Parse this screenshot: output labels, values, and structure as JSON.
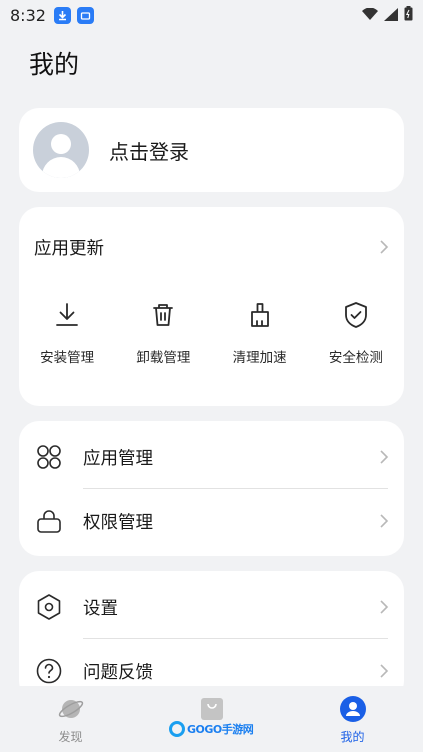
{
  "status_bar": {
    "time": "8:32",
    "icons": [
      "download-icon",
      "app-store-icon",
      "wifi-icon",
      "signal-icon",
      "battery-icon"
    ]
  },
  "page": {
    "title": "我的"
  },
  "login": {
    "label": "点击登录",
    "avatar_icon": "default-avatar-icon"
  },
  "update_card": {
    "title": "应用更新",
    "tools": [
      {
        "label": "安装管理",
        "icon": "download-tray-icon"
      },
      {
        "label": "卸载管理",
        "icon": "trash-icon"
      },
      {
        "label": "清理加速",
        "icon": "brush-icon"
      },
      {
        "label": "安全检测",
        "icon": "shield-check-icon"
      }
    ]
  },
  "menu_group_1": [
    {
      "label": "应用管理",
      "icon": "grid-icon"
    },
    {
      "label": "权限管理",
      "icon": "lock-icon"
    }
  ],
  "menu_group_2": [
    {
      "label": "设置",
      "icon": "hexagon-settings-icon"
    },
    {
      "label": "问题反馈",
      "icon": "question-icon"
    }
  ],
  "bottom_nav": {
    "items": [
      {
        "label": "发现",
        "icon": "planet-icon",
        "active": false
      },
      {
        "label": "",
        "icon": "shopping-bag-icon",
        "active": false
      },
      {
        "label": "我的",
        "icon": "user-icon",
        "active": true
      }
    ],
    "watermark": "GOGO手游网"
  },
  "colors": {
    "accent": "#1a5fe6",
    "background": "#f1f2f4",
    "card": "#ffffff"
  }
}
